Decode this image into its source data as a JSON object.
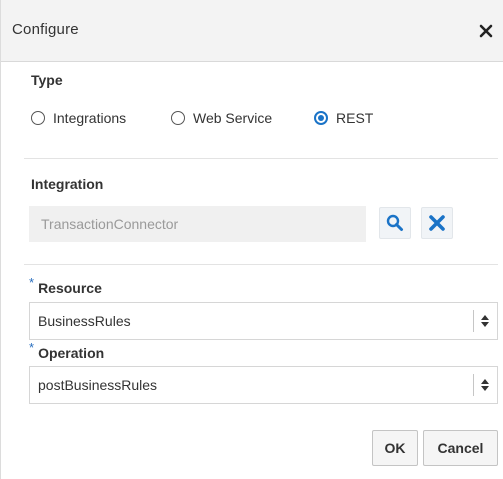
{
  "dialog": {
    "title": "Configure",
    "close_icon": "close-icon"
  },
  "type_section": {
    "label": "Type",
    "options": [
      {
        "label": "Integrations",
        "checked": false
      },
      {
        "label": "Web Service",
        "checked": false
      },
      {
        "label": "REST",
        "checked": true
      }
    ]
  },
  "integration_section": {
    "label": "Integration",
    "value": "TransactionConnector",
    "search_icon": "search-icon",
    "clear_icon": "clear-icon"
  },
  "resource": {
    "required_mark": "*",
    "label": "Resource",
    "value": "BusinessRules"
  },
  "operation": {
    "required_mark": "*",
    "label": "Operation",
    "value": "postBusinessRules"
  },
  "buttons": {
    "ok_label": "OK",
    "cancel_label": "Cancel"
  },
  "colors": {
    "accent": "#1a73c7",
    "title_bar": "#f3f3f3"
  }
}
